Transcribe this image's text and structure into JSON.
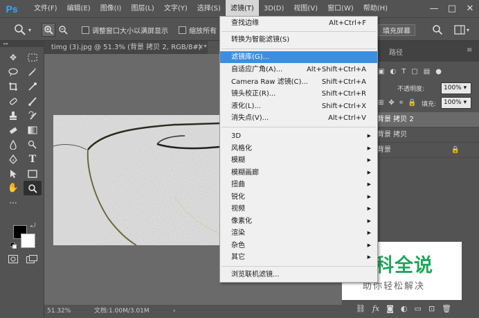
{
  "app": {
    "logo": "Ps"
  },
  "menubar": {
    "items": [
      "文件(F)",
      "编辑(E)",
      "图像(I)",
      "图层(L)",
      "文字(Y)",
      "选择(S)",
      "滤镜(T)",
      "3D(D)",
      "视图(V)",
      "窗口(W)",
      "帮助(H)"
    ],
    "active": "滤镜(T)"
  },
  "window_controls": {
    "minimize": "—",
    "restore": "□",
    "close": "✕"
  },
  "options": {
    "resize_windows_label": "调整窗口大小以满屏显示",
    "zoom_all_label": "缩放所有",
    "fill_screen_label": "填充屏幕"
  },
  "document": {
    "tab_title": "timg (3).jpg @ 51.3% (背景 拷贝 2, RGB/8#) *",
    "zoom": "51.32%",
    "doc_info": "文档:1.00M/3.01M"
  },
  "panel": {
    "tab_paths": "路径",
    "opacity_label": "不透明度:",
    "opacity_value": "100%",
    "fill_label": "填充:",
    "fill_value": "100%",
    "layers": [
      "背景 拷贝 2",
      "背景 拷贝",
      "背景"
    ]
  },
  "filter_menu": {
    "items": [
      {
        "label": "查找边缘",
        "shortcut": "Alt+Ctrl+F"
      },
      {
        "label": "转换为智能滤镜(S)",
        "shortcut": ""
      },
      {
        "label": "滤镜库(G)...",
        "shortcut": ""
      },
      {
        "label": "自适应广角(A)...",
        "shortcut": "Alt+Shift+Ctrl+A"
      },
      {
        "label": "Camera Raw 滤镜(C)...",
        "shortcut": "Shift+Ctrl+A"
      },
      {
        "label": "镜头校正(R)...",
        "shortcut": "Shift+Ctrl+R"
      },
      {
        "label": "液化(L)...",
        "shortcut": "Shift+Ctrl+X"
      },
      {
        "label": "消失点(V)...",
        "shortcut": "Alt+Ctrl+V"
      },
      {
        "label": "3D",
        "shortcut": ""
      },
      {
        "label": "风格化",
        "shortcut": ""
      },
      {
        "label": "模糊",
        "shortcut": ""
      },
      {
        "label": "模糊画廊",
        "shortcut": ""
      },
      {
        "label": "扭曲",
        "shortcut": ""
      },
      {
        "label": "锐化",
        "shortcut": ""
      },
      {
        "label": "视频",
        "shortcut": ""
      },
      {
        "label": "像素化",
        "shortcut": ""
      },
      {
        "label": "渲染",
        "shortcut": ""
      },
      {
        "label": "杂色",
        "shortcut": ""
      },
      {
        "label": "其它",
        "shortcut": ""
      },
      {
        "label": "浏览联机滤镜...",
        "shortcut": ""
      }
    ],
    "highlighted": "滤镜库(G)..."
  },
  "watermark": {
    "title": "百科全说",
    "subtitle": "助你轻松解决"
  },
  "colors": {
    "ps_blue": "#31a8ff",
    "menu_highlight": "#3b8ee0",
    "watermark_green": "#1ea65a"
  }
}
